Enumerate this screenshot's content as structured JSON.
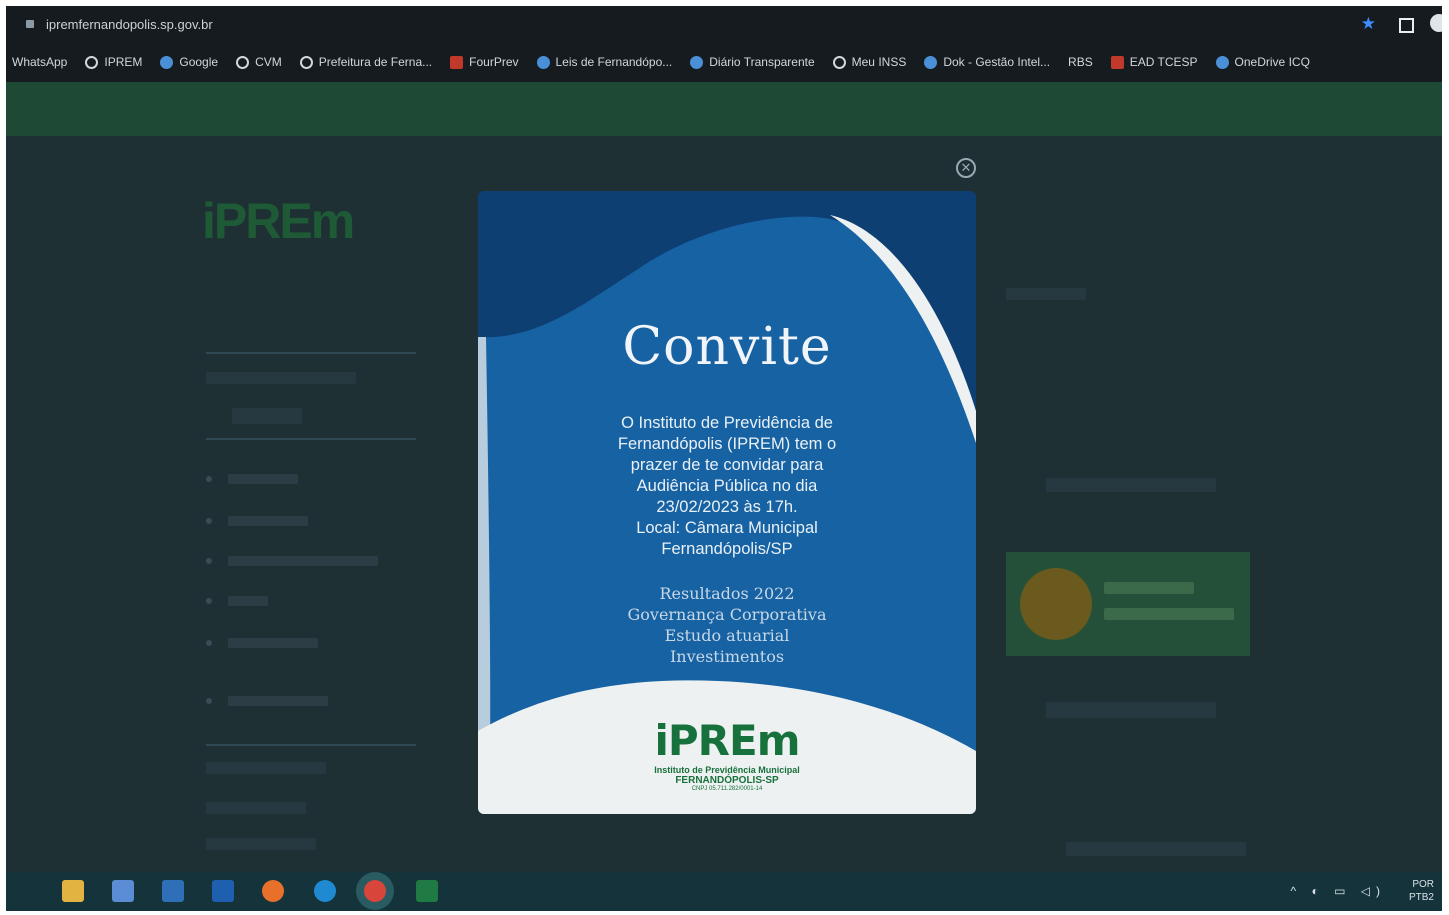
{
  "browser": {
    "url": "ipremfernandopolis.sp.gov.br",
    "bookmarks": [
      {
        "label": "WhatsApp",
        "icon": "none"
      },
      {
        "label": "IPREM",
        "icon": "globe-icon"
      },
      {
        "label": "Google",
        "icon": "drop-icon"
      },
      {
        "label": "CVM",
        "icon": "globe-icon"
      },
      {
        "label": "Prefeitura de Ferna...",
        "icon": "globe-icon"
      },
      {
        "label": "FourPrev",
        "icon": "fourprev-icon"
      },
      {
        "label": "Leis de Fernandópo...",
        "icon": "drop-icon"
      },
      {
        "label": "Diário Transparente",
        "icon": "drop-icon"
      },
      {
        "label": "Meu INSS",
        "icon": "globe-icon"
      },
      {
        "label": "Dok - Gestão Intel...",
        "icon": "drop-icon"
      },
      {
        "label": "RBS",
        "icon": "none"
      },
      {
        "label": "EAD TCESP",
        "icon": "tcesp-icon"
      },
      {
        "label": "OneDrive ICQ",
        "icon": "onedrive-icon"
      }
    ]
  },
  "modal": {
    "title": "Convite",
    "body_lines": [
      "O Instituto de Previdência de",
      "Fernandópolis (IPREM) tem o",
      "prazer de te convidar para",
      "Audiência Pública no dia",
      "23/02/2023 às 17h.",
      "Local: Câmara Municipal",
      "Fernandópolis/SP"
    ],
    "topics": [
      "Resultados 2022",
      "Governança Corporativa",
      "Estudo atuarial",
      "Investimentos"
    ],
    "logo": {
      "mark": "iPREm",
      "line1": "Instituto de Previdência Municipal",
      "line2": "FERNANDÓPOLIS-SP",
      "line3": "CNPJ 05.711.282/0001-14"
    },
    "colors": {
      "card_blue": "#0d3f73",
      "wave_white": "#eef1f1",
      "logo_green": "#17713c"
    }
  },
  "taskbar": {
    "language": "POR",
    "keyboard": "PTB2"
  }
}
